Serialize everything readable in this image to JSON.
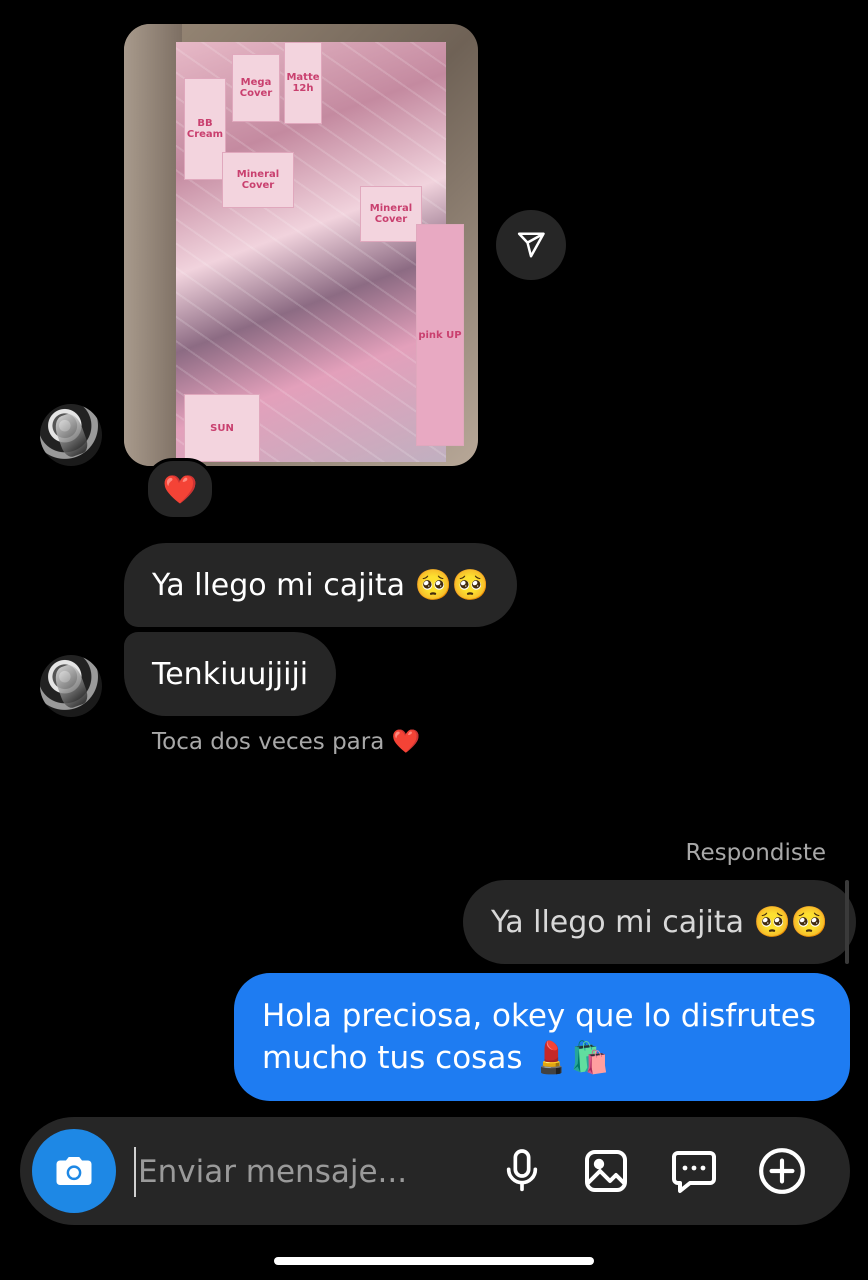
{
  "thread": {
    "received_image": {
      "reaction": "❤️"
    },
    "messages_in": [
      {
        "text": "Ya llego mi cajita 🥺🥺"
      },
      {
        "text": "Tenkiuujjiji"
      }
    ],
    "double_tap_hint": "Toca dos veces para ❤️",
    "reply": {
      "label": "Respondiste",
      "quoted_text": "Ya llego mi cajita 🥺🥺"
    },
    "outgoing_message": {
      "line1": "Hola preciosa, okey que lo disfrutes",
      "line2": "mucho tus cosas 💄🛍️"
    }
  },
  "composer": {
    "placeholder": "Enviar mensaje..."
  },
  "photo_labels": {
    "bb": "BB Cream",
    "mega": "Mega Cover",
    "matte": "Matte 12h",
    "mineral": "Mineral Cover",
    "pink_up": "pink UP",
    "sun": "SUN"
  }
}
